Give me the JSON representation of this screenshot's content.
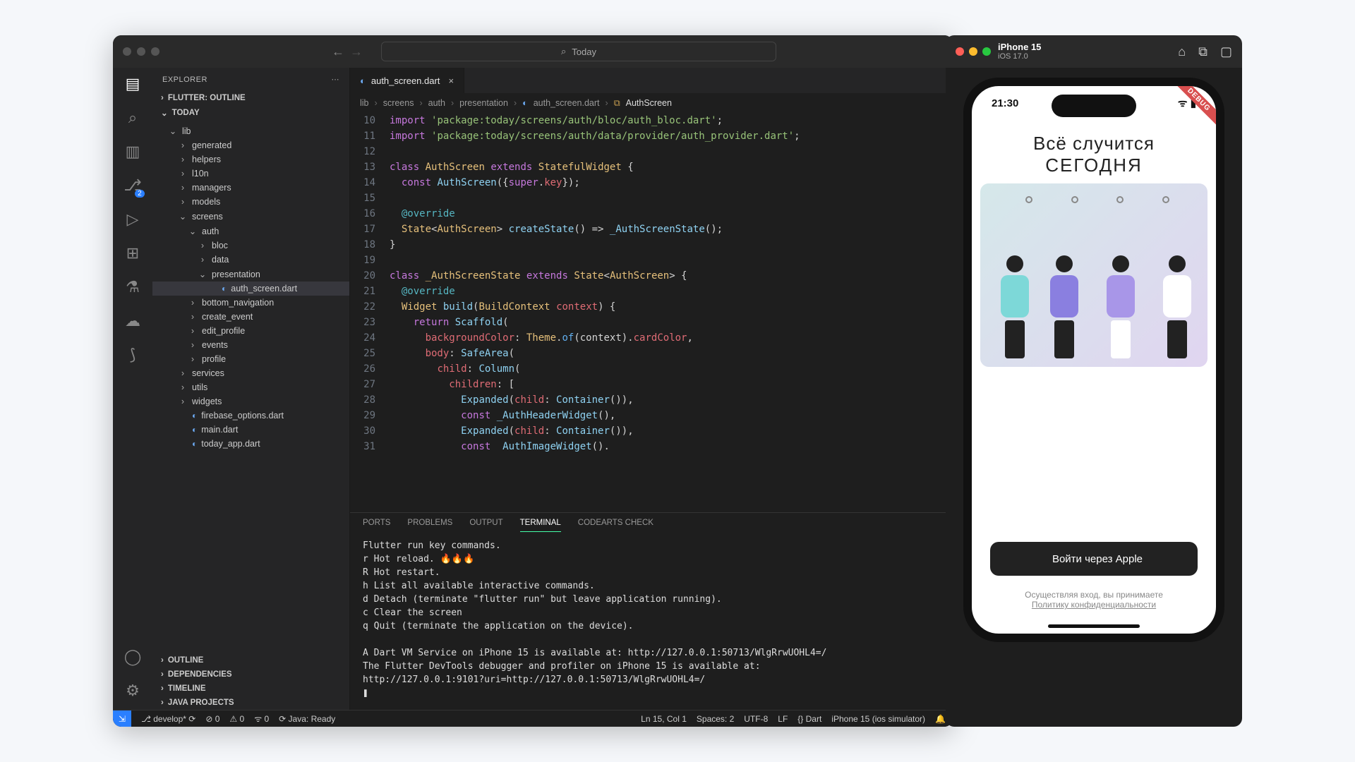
{
  "titlebar": {
    "search": "Today"
  },
  "explorer": {
    "title": "EXPLORER",
    "sections": [
      "FLUTTER: OUTLINE",
      "TODAY",
      "OUTLINE",
      "DEPENDENCIES",
      "TIMELINE",
      "JAVA PROJECTS"
    ],
    "tree": [
      {
        "d": 1,
        "t": "folder-open",
        "l": "lib"
      },
      {
        "d": 2,
        "t": "folder",
        "l": "generated"
      },
      {
        "d": 2,
        "t": "folder",
        "l": "helpers"
      },
      {
        "d": 2,
        "t": "folder",
        "l": "l10n"
      },
      {
        "d": 2,
        "t": "folder",
        "l": "managers"
      },
      {
        "d": 2,
        "t": "folder",
        "l": "models"
      },
      {
        "d": 2,
        "t": "folder-open",
        "l": "screens"
      },
      {
        "d": 3,
        "t": "folder-open",
        "l": "auth"
      },
      {
        "d": 4,
        "t": "folder",
        "l": "bloc"
      },
      {
        "d": 4,
        "t": "folder",
        "l": "data"
      },
      {
        "d": 4,
        "t": "folder-open",
        "l": "presentation"
      },
      {
        "d": 5,
        "t": "file",
        "l": "auth_screen.dart",
        "sel": true
      },
      {
        "d": 3,
        "t": "folder",
        "l": "bottom_navigation"
      },
      {
        "d": 3,
        "t": "folder",
        "l": "create_event"
      },
      {
        "d": 3,
        "t": "folder",
        "l": "edit_profile"
      },
      {
        "d": 3,
        "t": "folder",
        "l": "events"
      },
      {
        "d": 3,
        "t": "folder",
        "l": "profile"
      },
      {
        "d": 2,
        "t": "folder",
        "l": "services"
      },
      {
        "d": 2,
        "t": "folder",
        "l": "utils"
      },
      {
        "d": 2,
        "t": "folder",
        "l": "widgets"
      },
      {
        "d": 2,
        "t": "file",
        "l": "firebase_options.dart"
      },
      {
        "d": 2,
        "t": "file",
        "l": "main.dart"
      },
      {
        "d": 2,
        "t": "file",
        "l": "today_app.dart"
      }
    ]
  },
  "tab": {
    "name": "auth_screen.dart"
  },
  "crumbs": [
    "lib",
    "screens",
    "auth",
    "presentation",
    "auth_screen.dart",
    "AuthScreen"
  ],
  "code_start": 10,
  "code_lines": [
    "<span class='kw'>import</span> <span class='str'>'package:today/screens/auth/bloc/auth_bloc.dart'</span>;",
    "<span class='kw'>import</span> <span class='str'>'package:today/screens/auth/data/provider/auth_provider.dart'</span>;",
    "",
    "<span class='kw'>class</span> <span class='cls'>AuthScreen</span> <span class='kw'>extends</span> <span class='cls'>StatefulWidget</span> {",
    "  <span class='kw'>const</span> <span class='fn'>AuthScreen</span>({<span class='kw'>super</span>.<span class='par'>key</span>});",
    "",
    "  <span class='at'>@override</span>",
    "  <span class='cls'>State</span>&lt;<span class='cls'>AuthScreen</span>&gt; <span class='fn'>createState</span>() =&gt; <span class='fn'>_AuthScreenState</span>();",
    "}",
    "",
    "<span class='kw'>class</span> <span class='cls'>_AuthScreenState</span> <span class='kw'>extends</span> <span class='cls'>State</span>&lt;<span class='cls'>AuthScreen</span>&gt; {",
    "  <span class='at'>@override</span>",
    "  <span class='cls'>Widget</span> <span class='fn'>build</span>(<span class='cls'>BuildContext</span> <span class='par'>context</span>) {",
    "    <span class='kw'>return</span> <span class='fn'>Scaffold</span>(",
    "      <span class='par'>backgroundColor</span>: <span class='cls'>Theme</span>.<span class='blu'>of</span>(context).<span class='par'>cardColor</span>,",
    "      <span class='par'>body</span>: <span class='fn'>SafeArea</span>(",
    "        <span class='par'>child</span>: <span class='fn'>Column</span>(",
    "          <span class='par'>children</span>: [",
    "            <span class='fn'>Expanded</span>(<span class='par'>child</span>: <span class='fn'>Container</span>()),",
    "            <span class='kw'>const</span> <span class='fn'>_AuthHeaderWidget</span>(),",
    "            <span class='fn'>Expanded</span>(<span class='par'>child</span>: <span class='fn'>Container</span>()),",
    "            <span class='kw'>const</span>  <span class='fn'>AuthImageWidget</span>()."
  ],
  "panel_tabs": [
    "PORTS",
    "PROBLEMS",
    "OUTPUT",
    "TERMINAL",
    "CODEARTS CHECK"
  ],
  "terminal": "Flutter run key commands.\nr Hot reload. 🔥🔥🔥\nR Hot restart.\nh List all available interactive commands.\nd Detach (terminate \"flutter run\" but leave application running).\nc Clear the screen\nq Quit (terminate the application on the device).\n\nA Dart VM Service on iPhone 15 is available at: http://127.0.0.1:50713/WlgRrwUOHL4=/\nThe Flutter DevTools debugger and profiler on iPhone 15 is available at:\nhttp://127.0.0.1:9101?uri=http://127.0.0.1:50713/WlgRrwUOHL4=/\n❚",
  "status": {
    "branch": "develop*",
    "sync": "⟳",
    "errors": "⊘ 0",
    "warnings": "⚠ 0",
    "radio": "ᯤ 0",
    "java": "Java: Ready",
    "pos": "Ln 15, Col 1",
    "spaces": "Spaces: 2",
    "enc": "UTF-8",
    "eol": "LF",
    "lang": "{} Dart",
    "device": "iPhone 15 (ios simulator)"
  },
  "sim": {
    "title": "iPhone 15",
    "sub": "iOS 17.0",
    "time": "21:30",
    "ribbon": "DEBUG",
    "hero1": "Всё случится",
    "hero2": "СЕГОДНЯ",
    "btn": "Войти через Apple",
    "legal1": "Осуществляя вход, вы принимаете",
    "legal2": "Политику конфиденциальности"
  }
}
